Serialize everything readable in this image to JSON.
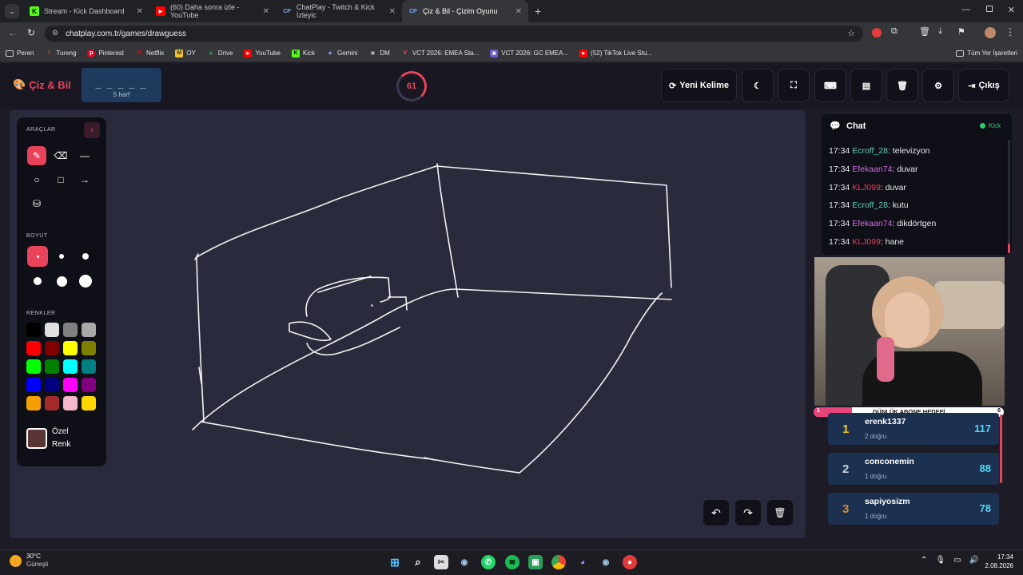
{
  "browser": {
    "tabs": [
      {
        "title": "Stream - Kick Dashboard",
        "favicon": "kick-icon",
        "active": false
      },
      {
        "title": "(60) Daha sonra izle - YouTube",
        "favicon": "youtube-icon",
        "active": false
      },
      {
        "title": "ChatPlay - Twitch & Kick İzleyic",
        "favicon": "chatplay-icon",
        "active": false
      },
      {
        "title": "Çiz & Bil - Çizim Oyunu",
        "favicon": "chatplay-icon",
        "active": true
      }
    ],
    "url": "chatplay.com.tr/games/drawguess",
    "bookmarks": [
      {
        "label": "Peren",
        "icon": "folder-icon"
      },
      {
        "label": "Tureng",
        "icon": "tureng-icon"
      },
      {
        "label": "Pinterest",
        "icon": "pinterest-icon"
      },
      {
        "label": "Netflix",
        "icon": "netflix-icon"
      },
      {
        "label": "OY",
        "icon": "m-icon"
      },
      {
        "label": "Drive",
        "icon": "drive-icon"
      },
      {
        "label": "YouTube",
        "icon": "youtube-icon"
      },
      {
        "label": "Kick",
        "icon": "kick-icon"
      },
      {
        "label": "Gemini",
        "icon": "gemini-icon"
      },
      {
        "label": "DM",
        "icon": "x-icon"
      },
      {
        "label": "VCT 2026: EMEA Sta...",
        "icon": "valorant-icon"
      },
      {
        "label": "VCT 2026: GC EMEA...",
        "icon": "vct-icon"
      },
      {
        "label": "(52) TikTok Live Stu...",
        "icon": "youtube-icon"
      }
    ],
    "other_bookmarks": "Tüm Yer İşaretleri"
  },
  "app": {
    "title": "Çiz & Bil",
    "word_mask": "_ _ _ _ _",
    "word_length_label": "5 harf",
    "timer": "61",
    "new_word_label": "Yeni Kelime",
    "exit_label": "Çıkış",
    "accent": "#e8435a"
  },
  "tools": {
    "section_tools": "ARAÇLAR",
    "section_size": "BOYUT",
    "section_colors": "RENKLER",
    "custom_color_label_1": "Özel",
    "custom_color_label_2": "Renk",
    "custom_color": "#5a3535",
    "colors": [
      "#000000",
      "#e0e0e0",
      "#808080",
      "#a9a9a9",
      "#ff0000",
      "#800000",
      "#ffff00",
      "#808000",
      "#00ff00",
      "#008000",
      "#00ffff",
      "#008080",
      "#0000ff",
      "#000080",
      "#ff00ff",
      "#800080",
      "#f5a000",
      "#a52a2a",
      "#f4b8c8",
      "#ffd700"
    ]
  },
  "chat": {
    "title": "Chat",
    "platform": "Kick",
    "messages": [
      {
        "time": "17:34",
        "user": "Ecroff_28",
        "text": "televizyon",
        "color": "#5fd0b0"
      },
      {
        "time": "17:34",
        "user": "Efekaan74",
        "text": "duvar",
        "color": "#d06ee0"
      },
      {
        "time": "17:34",
        "user": "KLJ099",
        "text": "duvar",
        "color": "#e0405a"
      },
      {
        "time": "17:34",
        "user": "Ecroff_28",
        "text": "kutu",
        "color": "#5fd0b0"
      },
      {
        "time": "17:34",
        "user": "Efekaan74",
        "text": "dikdörtgen",
        "color": "#d06ee0"
      },
      {
        "time": "17:34",
        "user": "KLJ099",
        "text": "hane",
        "color": "#e0405a"
      }
    ]
  },
  "goal": {
    "label": "GÜNLÜK ABONE HEDEFİ",
    "current": "1",
    "target": "6",
    "progress": 0.2
  },
  "leaderboard": [
    {
      "rank": "1",
      "name": "erenk1337",
      "sub": "2 doğru",
      "score": "117",
      "rank_color": "#f5c518"
    },
    {
      "rank": "2",
      "name": "conconemin",
      "sub": "1 doğru",
      "score": "88",
      "rank_color": "#c9d1dc"
    },
    {
      "rank": "3",
      "name": "sapiyosizm",
      "sub": "1 doğru",
      "score": "78",
      "rank_color": "#d08a3c"
    }
  ],
  "taskbar": {
    "weather_temp": "30°C",
    "weather_desc": "Güneşli",
    "time": "17:34",
    "date": "2.08.2026"
  }
}
